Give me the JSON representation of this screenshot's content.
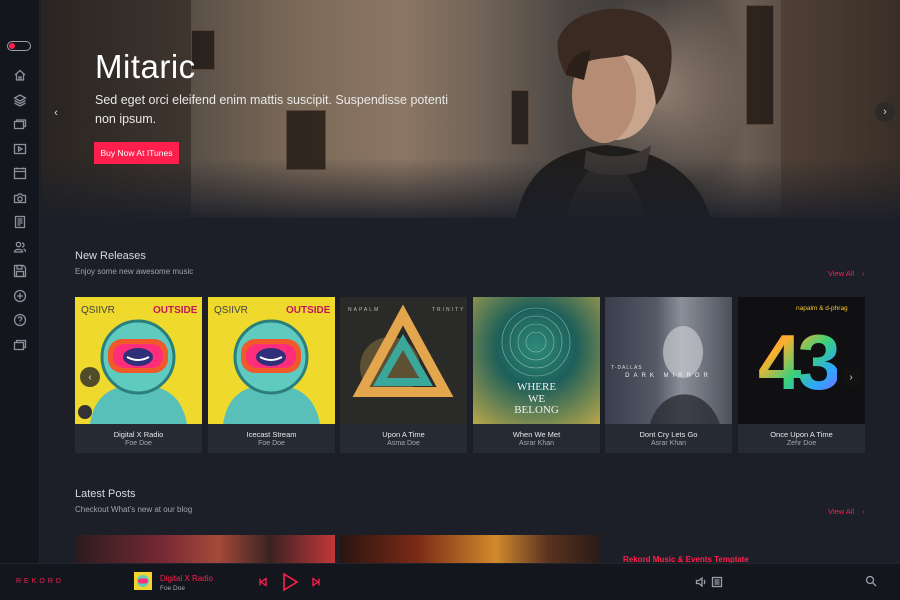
{
  "hero": {
    "title": "Mitaric",
    "subtitle": "Sed eget orci eleifend enim mattis suscipit. Suspendisse potenti non ipsum.",
    "button_label": "Buy Now At ITunes",
    "prev_icon": "chevron-left-icon",
    "next_icon": "chevron-right-icon"
  },
  "sidebar": {
    "items": [
      {
        "icon": "home-icon"
      },
      {
        "icon": "layers-icon"
      },
      {
        "icon": "albums-icon"
      },
      {
        "icon": "video-icon"
      },
      {
        "icon": "calendar-icon"
      },
      {
        "icon": "camera-icon"
      },
      {
        "icon": "document-icon"
      },
      {
        "icon": "users-icon"
      },
      {
        "icon": "save-icon"
      },
      {
        "icon": "plus-circle-icon"
      },
      {
        "icon": "help-icon"
      },
      {
        "icon": "gallery-icon"
      }
    ]
  },
  "new_releases": {
    "title": "New Releases",
    "subtitle": "Enjoy some new awesome music",
    "view_all": "View All",
    "view_all_arrow": "›",
    "albums": [
      {
        "title": "Digital X Radio",
        "artist": "Foe Doe",
        "cover_top_left": "QSIIVR",
        "cover_top_right": "OUTSIDE"
      },
      {
        "title": "Icecast Stream",
        "artist": "Foe Doe",
        "cover_top_left": "QSIIVR",
        "cover_top_right": "OUTSIDE"
      },
      {
        "title": "Upon A Time",
        "artist": "Asma Doe",
        "cover_top_left": "NAPALM",
        "cover_top_right": "TRINITY"
      },
      {
        "title": "When We Met",
        "artist": "Asrar Khan",
        "cover_line1": "WHERE",
        "cover_line2": "WE",
        "cover_line3": "BELONG"
      },
      {
        "title": "Dont Cry Lets Go",
        "artist": "Asrar Khan",
        "cover_top_left": "T-DALLAS",
        "cover_band": "DARK MIRROR"
      },
      {
        "title": "Once Upon A Time",
        "artist": "Zehr Doe",
        "cover_top_right": "napalm & d-phrag",
        "cover_number": "43"
      }
    ]
  },
  "latest_posts": {
    "title": "Latest Posts",
    "subtitle": "Checkout What's new at our blog",
    "view_all": "View All",
    "view_all_arrow": "›",
    "headline": "Rekord Music & Events Template"
  },
  "player": {
    "brand": "REKORD",
    "track_title": "Digital X Radio",
    "track_artist": "Foe Doe"
  },
  "colors": {
    "accent": "#ff1f4d",
    "background": "#1c1f28",
    "sidebar": "#14161d"
  }
}
